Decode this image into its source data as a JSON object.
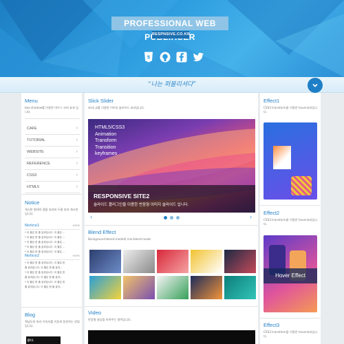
{
  "header": {
    "brand_title": "PROFESSIONAL WEB PUBLIHSER",
    "domain": "RESPNSIVE.CO.KR",
    "social_icons": [
      "html5-icon",
      "github-icon",
      "facebook-icon",
      "twitter-icon"
    ]
  },
  "quote": {
    "text": "“나는 퍼블리셔다”"
  },
  "menu": {
    "title": "Menu",
    "desc": "box-shadow를 이용한 마우스 오버 효과 입니다.",
    "items": [
      "CAFE",
      "TUTORIAL",
      "WEBSITE",
      "REFERENCE",
      "CSS3",
      "HTML5"
    ]
  },
  "notice": {
    "title": "Notice",
    "desc": "게시판 형태의 탭을 효과와 두줄 효과 게시판 입니다.",
    "tabs": [
      {
        "label": "Notice1",
        "more": "MORE",
        "lines": [
          "* 이 줄은 한 줄 효과입니다. 이 줄은 ...",
          "* 이 줄은 한 줄 효과입니다. 이 줄은 ...",
          "* 이 줄은 한 줄 효과입니다. 이 줄은 ...",
          "* 이 줄은 한 줄 효과입니다. 이 줄은 ...",
          "* 이 줄은 한 줄 효과입니다. 이 줄은 ..."
        ]
      },
      {
        "label": "Notice2",
        "more": "MORE",
        "lines": [
          "* 이 줄은 한 줄 효과입니다. 이 줄은 한",
          "  줄 효과입니다. 이 줄은 한 줄 효과...",
          "* 이 줄은 한 줄 효과입니다. 이 줄은 한",
          "  줄 효과입니다. 이 줄은 한 줄 효과...",
          "* 이 줄은 한 줄 효과입니다. 이 줄은 한",
          "  줄 효과입니다. 이 줄은 한 줄 효과..."
        ]
      }
    ]
  },
  "blog": {
    "title": "Blog",
    "desc": "책넘도와 따라 이미지를 이동게 동한하는 방법입니다.",
    "thumb_text": "@X1"
  },
  "slick": {
    "title": "Slick Slider",
    "desc": "slick.js를 이용한 이미지 슬라이드 효과입니다.",
    "slide_words": [
      "HTML5/CSS3",
      "Animation",
      "Transform",
      "Transition",
      "keyframes"
    ],
    "caption_title": "RESPONSIVE SITE2",
    "caption_sub": "슬라이드 플러그인을 이용한 반응형 이미지 슬라이드 입니다.",
    "prev": "‹",
    "next": "›"
  },
  "blend": {
    "title": "Blend Effect",
    "desc": "Background-blend-mode와 mix-blend-mode"
  },
  "video": {
    "title": "Video",
    "desc": "반응형 영상을 보여주는 영역입니다."
  },
  "effects": [
    {
      "title": "Effect1",
      "desc": "CSS3 transform을 이용한 hover효과입니다."
    },
    {
      "title": "Effect2",
      "desc": "CSS3 transform을 이용한 hover효과입니다.",
      "overlay": "Hover Effect"
    },
    {
      "title": "Effect3",
      "desc": "CSS3 transform을 이용한 hover효과입니다."
    }
  ],
  "colors": {
    "accent": "#1f7fc6",
    "header_blue": "#2f9ee0",
    "brand_box": "#8fc4e6"
  }
}
